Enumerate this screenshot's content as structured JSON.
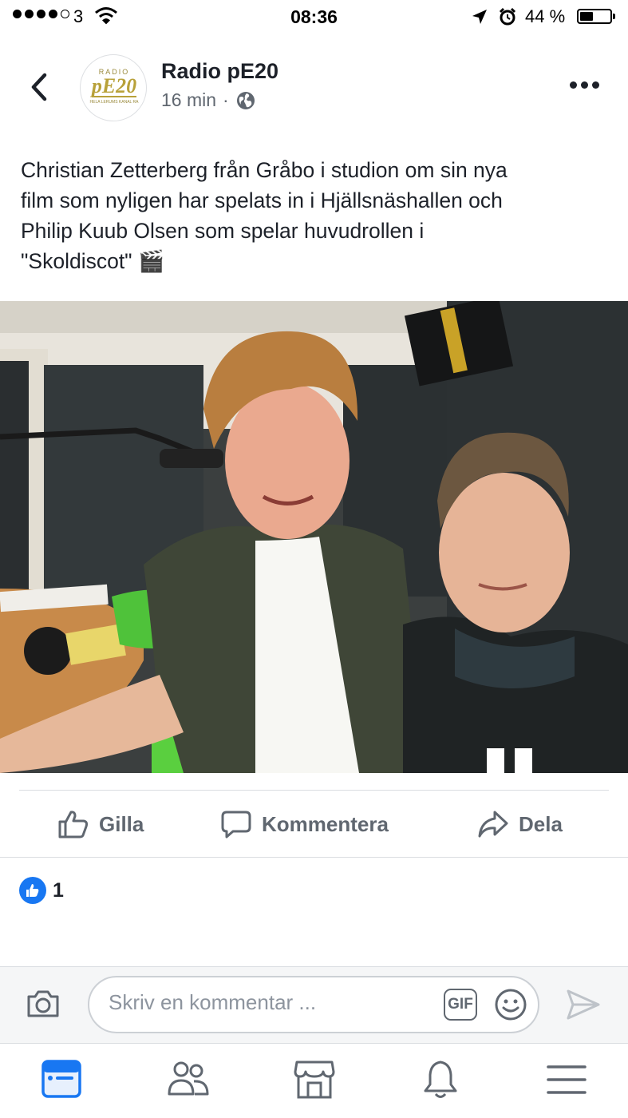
{
  "status_bar": {
    "carrier": "3",
    "time": "08:36",
    "battery": "44 %",
    "battery_level": 0.44
  },
  "post": {
    "avatar_logo_text": "RADIO pE20 HELA LERUMS KANAL RA",
    "page_name": "Radio pE20",
    "time_ago": "16 min",
    "separator": "·",
    "privacy_icon": "globe-icon",
    "text_lines": [
      "Christian Zetterberg från Gråbo i studion om sin nya",
      "film  som nyligen har spelats in i Hjällsnäshallen och",
      "Philip Kuub Olsen som spelar huvudrollen i",
      "\"Skoldiscot\" 🎬"
    ]
  },
  "actions": {
    "like": "Gilla",
    "comment": "Kommentera",
    "share": "Dela"
  },
  "reactions": {
    "count": "1"
  },
  "composer": {
    "placeholder": "Skriv en kommentar ...",
    "gif_label": "GIF"
  },
  "tabbar": {
    "items": [
      "news-feed-icon",
      "friends-icon",
      "marketplace-icon",
      "notifications-icon",
      "menu-icon"
    ],
    "active": "news-feed-icon",
    "active_color": "#1877f2",
    "inactive_color": "#606770"
  }
}
